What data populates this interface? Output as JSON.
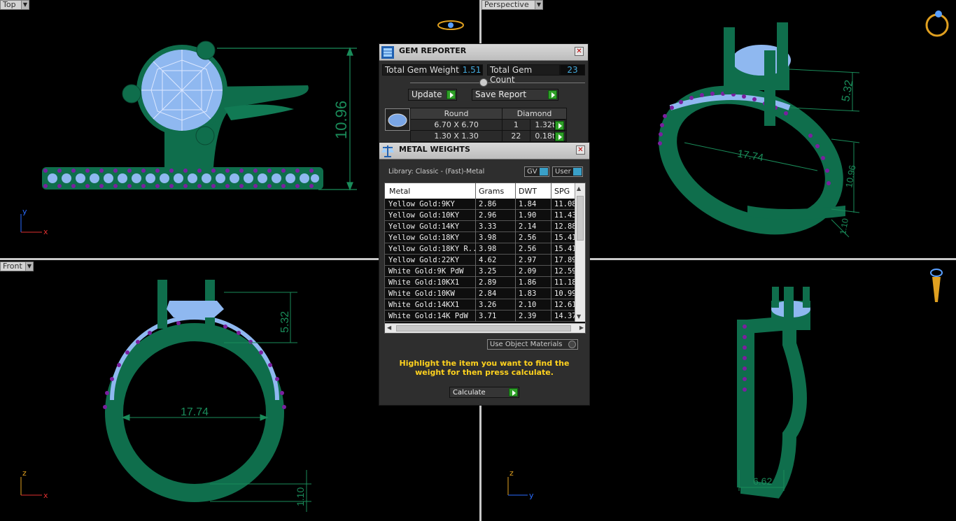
{
  "viewports": {
    "top": {
      "label": "Top",
      "height_dim": "10.96",
      "axis_x": "x",
      "axis_y": "y"
    },
    "perspective": {
      "label": "Perspective",
      "dim_a": "5.32",
      "dim_b": "17.74",
      "dim_c": "10.96",
      "dim_d": "1.10"
    },
    "front": {
      "label": "Front",
      "dim_top": "5.32",
      "dim_width": "17.74",
      "dim_bottom": "1.10",
      "axis_z": "z",
      "axis_x": "x"
    },
    "right": {
      "dim_width": "6.62",
      "axis_z": "z",
      "axis_y": "y"
    }
  },
  "gem_reporter": {
    "title": "GEM REPORTER",
    "close": "✕",
    "total_weight_label": "Total Gem Weight",
    "total_weight_value": "1.51",
    "total_count_label": "Total Gem Count",
    "total_count_value": "23",
    "update_label": "Update",
    "save_report_label": "Save Report",
    "table_header": {
      "shape": "Round",
      "type": "Diamond"
    },
    "rows": [
      {
        "size": "6.70 X 6.70",
        "count": "1",
        "weight": "1.32tw"
      },
      {
        "size": "1.30 X 1.30",
        "count": "22",
        "weight": "0.18tw"
      }
    ]
  },
  "metal_weights": {
    "title": "METAL WEIGHTS",
    "close": "✕",
    "library": "Library: Classic - (Fast)-Metal",
    "gv_label": "GV",
    "user_label": "User",
    "columns": [
      "Metal",
      "Grams",
      "DWT",
      "SPG"
    ],
    "rows": [
      [
        "Yellow Gold:9KY",
        "2.86",
        "1.84",
        "11.08"
      ],
      [
        "Yellow Gold:10KY",
        "2.96",
        "1.90",
        "11.43"
      ],
      [
        "Yellow Gold:14KY",
        "3.33",
        "2.14",
        "12.88"
      ],
      [
        "Yellow Gold:18KY",
        "3.98",
        "2.56",
        "15.41"
      ],
      [
        "Yellow Gold:18KY R...",
        "3.98",
        "2.56",
        "15.41"
      ],
      [
        "Yellow Gold:22KY",
        "4.62",
        "2.97",
        "17.89"
      ],
      [
        "White Gold:9K PdW",
        "3.25",
        "2.09",
        "12.59"
      ],
      [
        "White Gold:10KX1",
        "2.89",
        "1.86",
        "11.18"
      ],
      [
        "White Gold:10KW",
        "2.84",
        "1.83",
        "10.99"
      ],
      [
        "White Gold:14KX1",
        "3.26",
        "2.10",
        "12.61"
      ],
      [
        "White Gold:14K PdW",
        "3.71",
        "2.39",
        "14.37"
      ]
    ],
    "use_object_materials": "Use Object Materials",
    "hint": "Highlight the item you want to find the weight for then press calculate.",
    "calculate_label": "Calculate"
  },
  "colors": {
    "metal": "#0f6e4c",
    "gem": "#8fb8f0",
    "accent_stones": "#7a1fa0",
    "dimension": "#1a8c5a",
    "hint": "#ffd21e"
  }
}
